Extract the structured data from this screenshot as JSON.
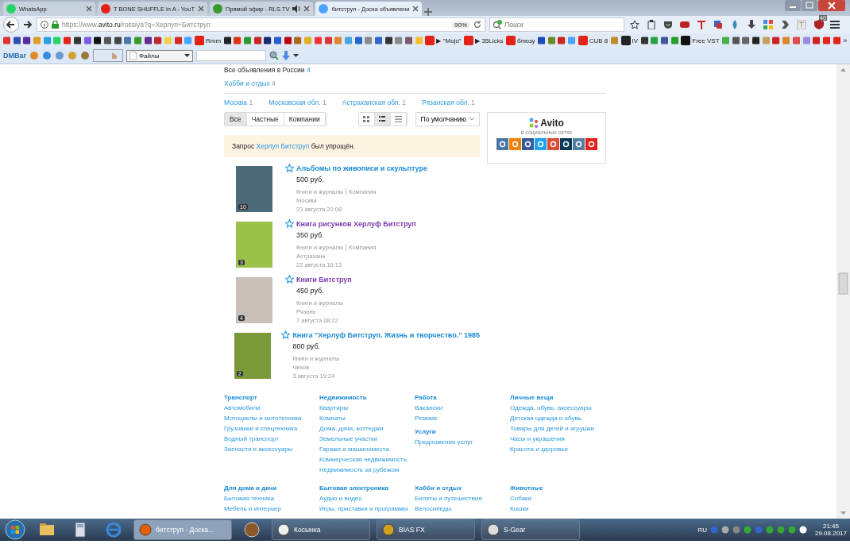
{
  "browser_tabs": [
    {
      "title": "WhatsApp",
      "color": "#25d366",
      "audio": false,
      "selected": false
    },
    {
      "title": "T BONE SHUFFLE in A - YouT",
      "color": "#e62117",
      "audio": false,
      "selected": false
    },
    {
      "title": "Прямой эфир - RLS.TV",
      "color": "#3a9a2a",
      "audio": true,
      "selected": false
    },
    {
      "title": "битструп - Доска объявлени",
      "color": "#4aa3ff",
      "audio": false,
      "selected": true
    }
  ],
  "nav": {
    "url_scheme": "https://www.",
    "url_host": "avito.ru",
    "url_path": "/rossiya?q=Херлуп+Битструп",
    "zoom": "90%",
    "search_placeholder": "Поиск",
    "badge": "40"
  },
  "bookmarks": [
    {
      "color": "#d33"
    },
    {
      "color": "#2a4fb5"
    },
    {
      "color": "#5b2a9e"
    },
    {
      "color": "#e09a2a"
    },
    {
      "color": "#2a9ee0"
    },
    {
      "color": "#25d366"
    },
    {
      "color": "#e62117"
    },
    {
      "color": "#333333"
    },
    {
      "color": "#7a5ae0"
    },
    {
      "color": "#111111"
    },
    {
      "color": "#555555"
    },
    {
      "color": "#444444"
    },
    {
      "color": "#4a76a8"
    },
    {
      "color": "#3a9a2a"
    },
    {
      "color": "#6a2a8e"
    },
    {
      "color": "#c0282d"
    },
    {
      "color": "#f2d04a"
    },
    {
      "color": "#d52b1e"
    },
    {
      "color": "#4aa3ff"
    },
    {
      "color": "#e62117",
      "label": "Rmm"
    },
    {
      "color": "#222222"
    },
    {
      "color": "#d31"
    },
    {
      "color": "#2a9a2a"
    },
    {
      "color": "#c22"
    },
    {
      "color": "#1a2a6e"
    },
    {
      "color": "#2a5ad0"
    },
    {
      "color": "#b00"
    },
    {
      "color": "#b06a20"
    },
    {
      "color": "#e0b020"
    },
    {
      "color": "#e33"
    },
    {
      "color": "#d33"
    },
    {
      "color": "#e0852a"
    },
    {
      "color": "#4aa3e0"
    },
    {
      "color": "#2266cc"
    },
    {
      "color": "#888888"
    },
    {
      "color": "#3366cc"
    },
    {
      "color": "#333333"
    },
    {
      "color": "#888888"
    },
    {
      "color": "#7a5a6a"
    },
    {
      "color": "#f2c02a"
    },
    {
      "color": "#e62117",
      "label": "▶ \"Mojo\""
    },
    {
      "color": "#e62117",
      "label": "▶ 35Licks"
    },
    {
      "color": "#e62117",
      "label": "блюзу"
    },
    {
      "color": "#1a4ab5"
    },
    {
      "color": "#6a8a2a"
    },
    {
      "color": "#c22"
    },
    {
      "color": "#4aa3ff"
    },
    {
      "color": "#e62117",
      "label": "CUB 8"
    },
    {
      "color": "#c08a2a"
    },
    {
      "color": "#222222",
      "label": "IV"
    },
    {
      "color": "#333333"
    },
    {
      "color": "#2aa04a"
    },
    {
      "color": "#3b5998"
    },
    {
      "color": "#2a9a2a"
    },
    {
      "color": "#111111",
      "label": "Free VST"
    },
    {
      "color": "#4ab04a"
    },
    {
      "color": "#555555"
    },
    {
      "color": "#666666"
    },
    {
      "color": "#222222"
    },
    {
      "color": "#c0a060"
    },
    {
      "color": "#c22"
    },
    {
      "color": "#e0852a"
    },
    {
      "color": "#e04a4a"
    },
    {
      "color": "#9a8ae0"
    },
    {
      "color": "#c22"
    },
    {
      "color": "#e62117"
    },
    {
      "color": "#e62117"
    }
  ],
  "bookmarks_more": "»",
  "dm_bar": {
    "logo": "DMBar",
    "files": "Файлы"
  },
  "page": {
    "all_ads": "Все объявления в России",
    "all_ads_count": "4",
    "category": "Хобби и отдых",
    "category_count": "4",
    "regions": [
      {
        "name": "Москва",
        "count": "1"
      },
      {
        "name": "Московская обл.",
        "count": "1"
      },
      {
        "name": "Астраханская обл.",
        "count": "1"
      },
      {
        "name": "Рязанская обл.",
        "count": "1"
      }
    ],
    "seller_filter": [
      {
        "label": "Все",
        "selected": true
      },
      {
        "label": "Частные",
        "selected": false
      },
      {
        "label": "Компании",
        "selected": false
      }
    ],
    "view_modes": [
      {
        "kind": "grid",
        "selected": false
      },
      {
        "kind": "list",
        "selected": true
      },
      {
        "kind": "lines",
        "selected": false
      }
    ],
    "sort": "По умолчанию",
    "notice": {
      "before": "Запрос",
      "query": "Херлуп Битструп",
      "after": "был упрощён."
    },
    "listings": [
      {
        "title": "Альбомы по живописи и скульптуре",
        "visited": false,
        "price": "500 руб.",
        "category": "Книги и журналы",
        "seller": "Компания",
        "city": "Москва",
        "date": "23 августа 20:08",
        "photos": "10",
        "color": "#4a6a7a"
      },
      {
        "title": "Книга рисунков Херлуф Битструп",
        "visited": true,
        "price": "350 руб.",
        "category": "Книги и журналы",
        "seller": "Компания",
        "city": "Астрахань",
        "date": "22 августа 16:13",
        "photos": "3",
        "color": "#9ac24a"
      },
      {
        "title": "Книги Битструп",
        "visited": true,
        "price": "450 руб.",
        "category": "Книги и журналы",
        "city": "Рязань",
        "date": "7 августа 08:22",
        "photos": "4",
        "color": "#c8c0b8"
      },
      {
        "title": "Книга \"Херлуф Битструп. Жизнь и творчество.\" 1985",
        "visited": false,
        "price": "800 руб.",
        "category": "Книги и журналы",
        "city": "Чехов",
        "date": "3 августа 19:24",
        "photos": "2",
        "color": "#7a9a3a"
      }
    ],
    "social": {
      "logo": "Avito",
      "caption": "в социальных сетях",
      "networks": [
        {
          "color": "#4a76a8"
        },
        {
          "color": "#ee8208"
        },
        {
          "color": "#3b5998"
        },
        {
          "color": "#1da1f2"
        },
        {
          "color": "#dd4b39"
        },
        {
          "color": "#0a3a5a"
        },
        {
          "color": "#517fa4"
        },
        {
          "color": "#e62117"
        }
      ]
    },
    "footer": [
      [
        {
          "heading": "Транспорт",
          "links": [
            "Автомобили",
            "Мотоциклы и мототехника",
            "Грузовики и спецтехника",
            "Водный транспорт",
            "Запчасти и аксессуары"
          ]
        }
      ],
      [
        {
          "heading": "Недвижимость",
          "links": [
            "Квартиры",
            "Комнаты",
            "Дома, дачи, коттеджи",
            "Земельные участки",
            "Гаражи и машиноместа",
            "Коммерческая недвижимость",
            "Недвижимость за рубежом"
          ]
        }
      ],
      [
        {
          "heading": "Работа",
          "links": [
            "Вакансии",
            "Резюме"
          ]
        },
        {
          "heading": "Услуги",
          "links": [
            "Предложение услуг"
          ]
        }
      ],
      [
        {
          "heading": "Личные вещи",
          "links": [
            "Одежда, обувь, аксессуары",
            "Детская одежда и обувь",
            "Товары для детей и игрушки",
            "Часы и украшения",
            "Красота и здоровье"
          ]
        }
      ],
      [
        {
          "heading": "Для дома и дачи",
          "links": [
            "Бытовая техника",
            "Мебель и интерьер"
          ]
        }
      ],
      [
        {
          "heading": "Бытовая электроника",
          "links": [
            "Аудио и видео",
            "Игры, приставки и программы"
          ]
        }
      ],
      [
        {
          "heading": "Хобби и отдых",
          "links": [
            "Билеты и путешествия",
            "Велосипеды"
          ]
        }
      ],
      [
        {
          "heading": "Животные",
          "links": [
            "Собаки",
            "Кошки"
          ]
        }
      ]
    ]
  },
  "taskbar": {
    "tasks": [
      {
        "title": "битструп - Доска...",
        "color": "#e66000",
        "selected": true
      },
      {
        "title": "Косынка",
        "color": "#eeeeee",
        "selected": false
      },
      {
        "title": "BIAS FX",
        "color": "#d0a020",
        "selected": false
      },
      {
        "title": "S-Gear",
        "color": "#dddddd",
        "selected": false
      }
    ],
    "lang": "RU",
    "time": "21:45",
    "date": "29.08.2017"
  }
}
